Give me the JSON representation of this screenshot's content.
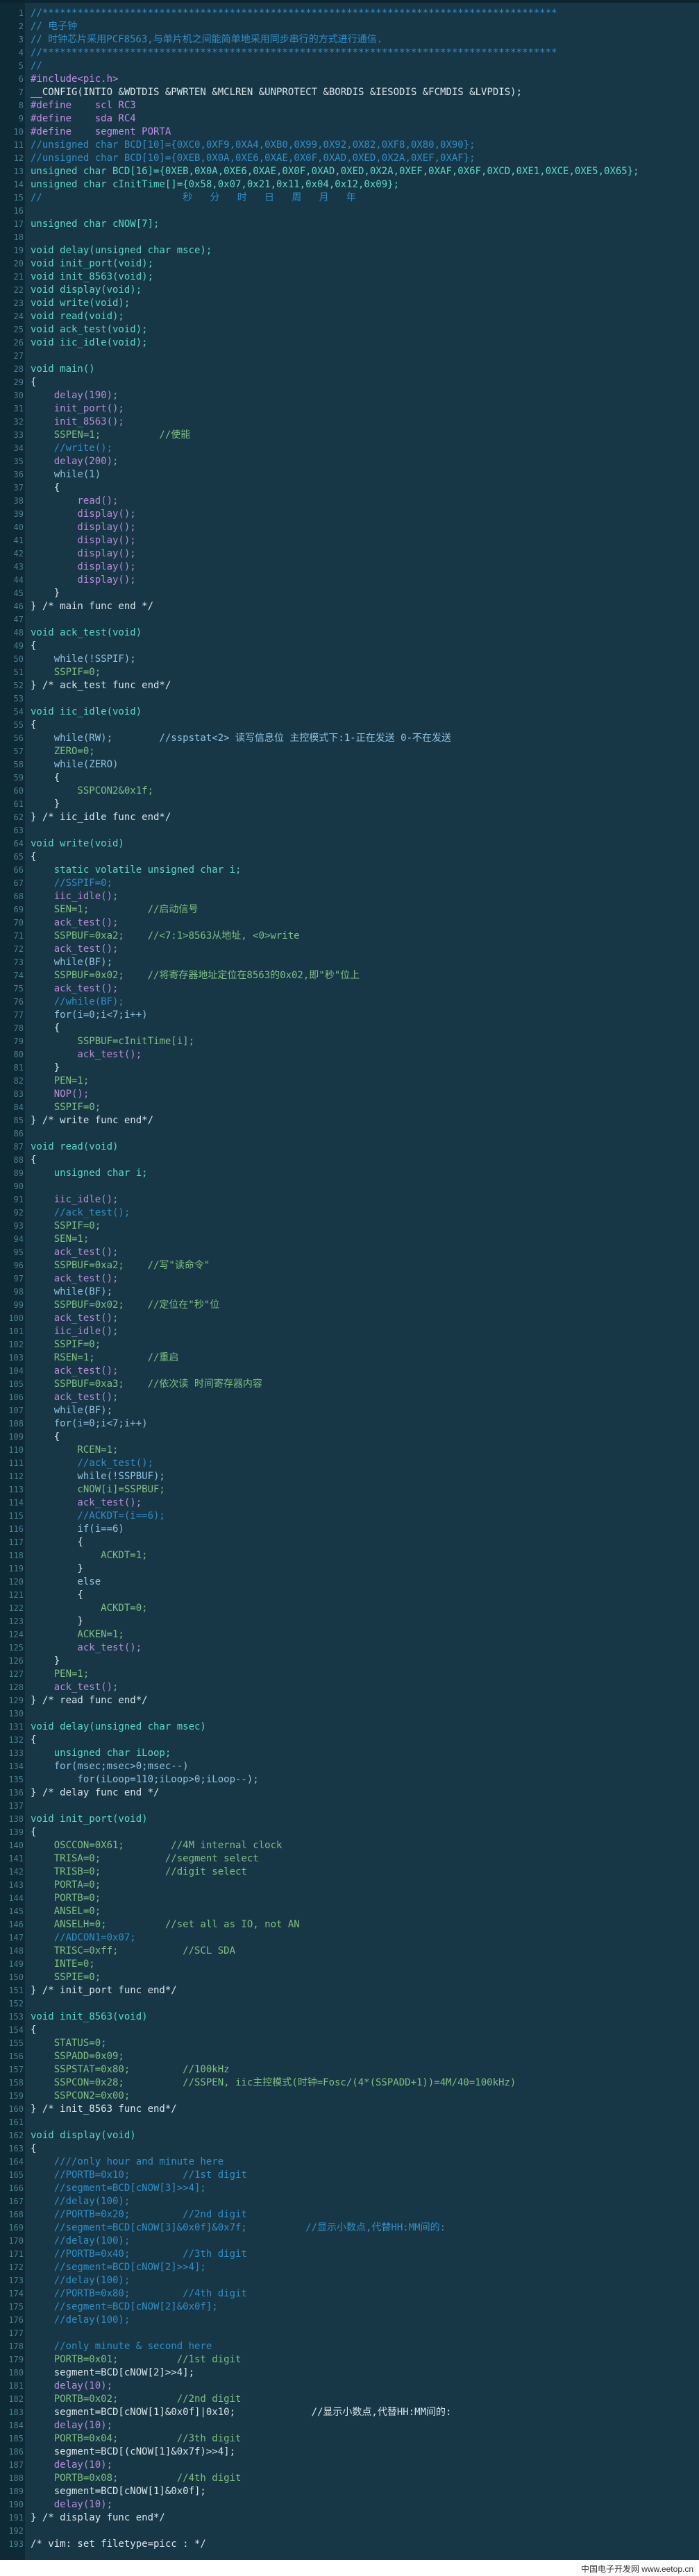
{
  "editor": {
    "lines": [
      {
        "n": "1",
        "t": "//****************************************************************************************",
        "c": "cm"
      },
      {
        "n": "2",
        "t": "// 电子钟",
        "c": "cm"
      },
      {
        "n": "3",
        "t": "// 时钟芯片采用PCF8563,与单片机之间能简单地采用同步串行的方式进行通信.",
        "c": "cm"
      },
      {
        "n": "4",
        "t": "//****************************************************************************************",
        "c": "cm"
      },
      {
        "n": "5",
        "t": "//",
        "c": "cm"
      },
      {
        "n": "6",
        "t": "#include<pic.h>",
        "c": "pp"
      },
      {
        "n": "7",
        "t": "__CONFIG(INTIO &WDTDIS &PWRTEN &MCLREN &UNPROTECT &BORDIS &IESODIS &FCMDIS &LVPDIS);",
        "c": ""
      },
      {
        "n": "8",
        "t": "#define    scl RC3",
        "c": "pp"
      },
      {
        "n": "9",
        "t": "#define    sda RC4",
        "c": "pp"
      },
      {
        "n": "10",
        "t": "#define    segment PORTA",
        "c": "pp"
      },
      {
        "n": "11",
        "t": "//unsigned char BCD[10]={0XC0,0XF9,0XA4,0XB0,0X99,0X92,0X82,0XF8,0X80,0X90};",
        "c": "cm"
      },
      {
        "n": "12",
        "t": "//unsigned char BCD[10]={0XEB,0X0A,0XE6,0XAE,0X0F,0XAD,0XED,0X2A,0XEF,0XAF};",
        "c": "cm"
      },
      {
        "n": "13",
        "t": "unsigned char BCD[16]={0XEB,0X0A,0XE6,0XAE,0X0F,0XAD,0XED,0X2A,0XEF,0XAF,0X6F,0XCD,0XE1,0XCE,0XE5,0X65};",
        "c": "ty"
      },
      {
        "n": "14",
        "t": "unsigned char cInitTime[]={0x58,0x07,0x21,0x11,0x04,0x12,0x09};",
        "c": "ty"
      },
      {
        "n": "15",
        "t": "//                        秒   分   时   日   周   月   年",
        "c": "cm"
      },
      {
        "n": "16",
        "t": "",
        "c": ""
      },
      {
        "n": "17",
        "t": "unsigned char cNOW[7];",
        "c": "ty"
      },
      {
        "n": "18",
        "t": "",
        "c": ""
      },
      {
        "n": "19",
        "t": "void delay(unsigned char msce);",
        "c": "ty"
      },
      {
        "n": "20",
        "t": "void init_port(void);",
        "c": "ty"
      },
      {
        "n": "21",
        "t": "void init_8563(void);",
        "c": "ty"
      },
      {
        "n": "22",
        "t": "void display(void);",
        "c": "ty"
      },
      {
        "n": "23",
        "t": "void write(void);",
        "c": "ty"
      },
      {
        "n": "24",
        "t": "void read(void);",
        "c": "ty"
      },
      {
        "n": "25",
        "t": "void ack_test(void);",
        "c": "ty"
      },
      {
        "n": "26",
        "t": "void iic_idle(void);",
        "c": "ty"
      },
      {
        "n": "27",
        "t": "",
        "c": ""
      },
      {
        "n": "28",
        "t": "void main()",
        "c": "ty"
      },
      {
        "n": "29",
        "t": "{",
        "c": ""
      },
      {
        "n": "30",
        "t": "    delay(190);",
        "c": "fn"
      },
      {
        "n": "31",
        "t": "    init_port();",
        "c": "fn"
      },
      {
        "n": "32",
        "t": "    init_8563();",
        "c": "fn"
      },
      {
        "n": "33",
        "t": "    SSPEN=1;          //使能",
        "c": "gr"
      },
      {
        "n": "34",
        "t": "    //write();",
        "c": "cm"
      },
      {
        "n": "35",
        "t": "    delay(200);",
        "c": "fn"
      },
      {
        "n": "36",
        "t": "    while(1)",
        "c": "kw"
      },
      {
        "n": "37",
        "t": "    {",
        "c": ""
      },
      {
        "n": "38",
        "t": "        read();",
        "c": "fn"
      },
      {
        "n": "39",
        "t": "        display();",
        "c": "fn"
      },
      {
        "n": "40",
        "t": "        display();",
        "c": "fn"
      },
      {
        "n": "41",
        "t": "        display();",
        "c": "fn"
      },
      {
        "n": "42",
        "t": "        display();",
        "c": "fn"
      },
      {
        "n": "43",
        "t": "        display();",
        "c": "fn"
      },
      {
        "n": "44",
        "t": "        display();",
        "c": "fn"
      },
      {
        "n": "45",
        "t": "    }",
        "c": ""
      },
      {
        "n": "46",
        "t": "} /* main func end */",
        "c": ""
      },
      {
        "n": "47",
        "t": "",
        "c": ""
      },
      {
        "n": "48",
        "t": "void ack_test(void)",
        "c": "ty"
      },
      {
        "n": "49",
        "t": "{",
        "c": ""
      },
      {
        "n": "50",
        "t": "    while(!SSPIF);",
        "c": "kw"
      },
      {
        "n": "51",
        "t": "    SSPIF=0;",
        "c": "gr"
      },
      {
        "n": "52",
        "t": "} /* ack_test func end*/",
        "c": ""
      },
      {
        "n": "53",
        "t": "",
        "c": ""
      },
      {
        "n": "54",
        "t": "void iic_idle(void)",
        "c": "ty"
      },
      {
        "n": "55",
        "t": "{",
        "c": ""
      },
      {
        "n": "56",
        "t": "    while(RW);        //sspstat<2> 读写信息位 主控模式下:1-正在发送 0-不在发送",
        "c": "kw"
      },
      {
        "n": "57",
        "t": "    ZERO=0;",
        "c": "gr"
      },
      {
        "n": "58",
        "t": "    while(ZERO)",
        "c": "kw"
      },
      {
        "n": "59",
        "t": "    {",
        "c": ""
      },
      {
        "n": "60",
        "t": "        SSPCON2&0x1f;",
        "c": "gr"
      },
      {
        "n": "61",
        "t": "    }",
        "c": ""
      },
      {
        "n": "62",
        "t": "} /* iic_idle func end*/",
        "c": ""
      },
      {
        "n": "63",
        "t": "",
        "c": ""
      },
      {
        "n": "64",
        "t": "void write(void)",
        "c": "ty"
      },
      {
        "n": "65",
        "t": "{",
        "c": ""
      },
      {
        "n": "66",
        "t": "    static volatile unsigned char i;",
        "c": "ty"
      },
      {
        "n": "67",
        "t": "    //SSPIF=0;",
        "c": "cm"
      },
      {
        "n": "68",
        "t": "    iic_idle();",
        "c": "fn"
      },
      {
        "n": "69",
        "t": "    SEN=1;          //启动信号",
        "c": "gr"
      },
      {
        "n": "70",
        "t": "    ack_test();",
        "c": "fn"
      },
      {
        "n": "71",
        "t": "    SSPBUF=0xa2;    //<7:1>8563从地址, <0>write",
        "c": "gr"
      },
      {
        "n": "72",
        "t": "    ack_test();",
        "c": "fn"
      },
      {
        "n": "73",
        "t": "    while(BF);",
        "c": "kw"
      },
      {
        "n": "74",
        "t": "    SSPBUF=0x02;    //将寄存器地址定位在8563的0x02,即\"秒\"位上",
        "c": "gr"
      },
      {
        "n": "75",
        "t": "    ack_test();",
        "c": "fn"
      },
      {
        "n": "76",
        "t": "    //while(BF);",
        "c": "cm"
      },
      {
        "n": "77",
        "t": "    for(i=0;i<7;i++)",
        "c": "kw"
      },
      {
        "n": "78",
        "t": "    {",
        "c": ""
      },
      {
        "n": "79",
        "t": "        SSPBUF=cInitTime[i];",
        "c": "gr"
      },
      {
        "n": "80",
        "t": "        ack_test();",
        "c": "fn"
      },
      {
        "n": "81",
        "t": "    }",
        "c": ""
      },
      {
        "n": "82",
        "t": "    PEN=1;",
        "c": "gr"
      },
      {
        "n": "83",
        "t": "    NOP();",
        "c": "fn"
      },
      {
        "n": "84",
        "t": "    SSPIF=0;",
        "c": "gr"
      },
      {
        "n": "85",
        "t": "} /* write func end*/",
        "c": ""
      },
      {
        "n": "86",
        "t": "",
        "c": ""
      },
      {
        "n": "87",
        "t": "void read(void)",
        "c": "ty"
      },
      {
        "n": "88",
        "t": "{",
        "c": ""
      },
      {
        "n": "89",
        "t": "    unsigned char i;",
        "c": "ty"
      },
      {
        "n": "90",
        "t": "",
        "c": ""
      },
      {
        "n": "91",
        "t": "    iic_idle();",
        "c": "fn"
      },
      {
        "n": "92",
        "t": "    //ack_test();",
        "c": "cm"
      },
      {
        "n": "93",
        "t": "    SSPIF=0;",
        "c": "gr"
      },
      {
        "n": "94",
        "t": "    SEN=1;",
        "c": "gr"
      },
      {
        "n": "95",
        "t": "    ack_test();",
        "c": "fn"
      },
      {
        "n": "96",
        "t": "    SSPBUF=0xa2;    //写\"读命令\"",
        "c": "gr"
      },
      {
        "n": "97",
        "t": "    ack_test();",
        "c": "fn"
      },
      {
        "n": "98",
        "t": "    while(BF);",
        "c": "kw"
      },
      {
        "n": "99",
        "t": "    SSPBUF=0x02;    //定位在\"秒\"位",
        "c": "gr"
      },
      {
        "n": "100",
        "t": "    ack_test();",
        "c": "fn"
      },
      {
        "n": "101",
        "t": "    iic_idle();",
        "c": "fn"
      },
      {
        "n": "102",
        "t": "    SSPIF=0;",
        "c": "gr"
      },
      {
        "n": "103",
        "t": "    RSEN=1;         //重启",
        "c": "gr"
      },
      {
        "n": "104",
        "t": "    ack_test();",
        "c": "fn"
      },
      {
        "n": "105",
        "t": "    SSPBUF=0xa3;    //依次读 时间寄存器内容",
        "c": "gr"
      },
      {
        "n": "106",
        "t": "    ack_test();",
        "c": "fn"
      },
      {
        "n": "107",
        "t": "    while(BF);",
        "c": "kw"
      },
      {
        "n": "108",
        "t": "    for(i=0;i<7;i++)",
        "c": "kw"
      },
      {
        "n": "109",
        "t": "    {",
        "c": ""
      },
      {
        "n": "110",
        "t": "        RCEN=1;",
        "c": "gr"
      },
      {
        "n": "111",
        "t": "        //ack_test();",
        "c": "cm"
      },
      {
        "n": "112",
        "t": "        while(!SSPBUF);",
        "c": "kw"
      },
      {
        "n": "113",
        "t": "        cNOW[i]=SSPBUF;",
        "c": "gr"
      },
      {
        "n": "114",
        "t": "        ack_test();",
        "c": "fn"
      },
      {
        "n": "115",
        "t": "        //ACKDT=(i==6);",
        "c": "cm"
      },
      {
        "n": "116",
        "t": "        if(i==6)",
        "c": "kw"
      },
      {
        "n": "117",
        "t": "        {",
        "c": ""
      },
      {
        "n": "118",
        "t": "            ACKDT=1;",
        "c": "gr"
      },
      {
        "n": "119",
        "t": "        }",
        "c": ""
      },
      {
        "n": "120",
        "t": "        else",
        "c": "kw"
      },
      {
        "n": "121",
        "t": "        {",
        "c": ""
      },
      {
        "n": "122",
        "t": "            ACKDT=0;",
        "c": "gr"
      },
      {
        "n": "123",
        "t": "        }",
        "c": ""
      },
      {
        "n": "124",
        "t": "        ACKEN=1;",
        "c": "gr"
      },
      {
        "n": "125",
        "t": "        ack_test();",
        "c": "fn"
      },
      {
        "n": "126",
        "t": "    }",
        "c": ""
      },
      {
        "n": "127",
        "t": "    PEN=1;",
        "c": "gr"
      },
      {
        "n": "128",
        "t": "    ack_test();",
        "c": "fn"
      },
      {
        "n": "129",
        "t": "} /* read func end*/",
        "c": ""
      },
      {
        "n": "130",
        "t": "",
        "c": ""
      },
      {
        "n": "131",
        "t": "void delay(unsigned char msec)",
        "c": "ty"
      },
      {
        "n": "132",
        "t": "{",
        "c": ""
      },
      {
        "n": "133",
        "t": "    unsigned char iLoop;",
        "c": "ty"
      },
      {
        "n": "134",
        "t": "    for(msec;msec>0;msec--)",
        "c": "kw"
      },
      {
        "n": "135",
        "t": "        for(iLoop=110;iLoop>0;iLoop--);",
        "c": "kw"
      },
      {
        "n": "136",
        "t": "} /* delay func end */",
        "c": ""
      },
      {
        "n": "137",
        "t": "",
        "c": ""
      },
      {
        "n": "138",
        "t": "void init_port(void)",
        "c": "ty"
      },
      {
        "n": "139",
        "t": "{",
        "c": ""
      },
      {
        "n": "140",
        "t": "    OSCCON=0X61;        //4M internal clock",
        "c": "gr"
      },
      {
        "n": "141",
        "t": "    TRISA=0;           //segment select",
        "c": "gr"
      },
      {
        "n": "142",
        "t": "    TRISB=0;           //digit select",
        "c": "gr"
      },
      {
        "n": "143",
        "t": "    PORTA=0;",
        "c": "gr"
      },
      {
        "n": "144",
        "t": "    PORTB=0;",
        "c": "gr"
      },
      {
        "n": "145",
        "t": "    ANSEL=0;",
        "c": "gr"
      },
      {
        "n": "146",
        "t": "    ANSELH=0;          //set all as IO, not AN",
        "c": "gr"
      },
      {
        "n": "147",
        "t": "    //ADCON1=0x07;",
        "c": "cm"
      },
      {
        "n": "148",
        "t": "    TRISC=0xff;           //SCL SDA",
        "c": "gr"
      },
      {
        "n": "149",
        "t": "    INTE=0;",
        "c": "gr"
      },
      {
        "n": "150",
        "t": "    SSPIE=0;",
        "c": "gr"
      },
      {
        "n": "151",
        "t": "} /* init_port func end*/",
        "c": ""
      },
      {
        "n": "152",
        "t": "",
        "c": ""
      },
      {
        "n": "153",
        "t": "void init_8563(void)",
        "c": "ty"
      },
      {
        "n": "154",
        "t": "{",
        "c": ""
      },
      {
        "n": "155",
        "t": "    STATUS=0;",
        "c": "gr"
      },
      {
        "n": "156",
        "t": "    SSPADD=0x09;",
        "c": "gr"
      },
      {
        "n": "157",
        "t": "    SSPSTAT=0x80;         //100kHz",
        "c": "gr"
      },
      {
        "n": "158",
        "t": "    SSPCON=0x28;          //SSPEN, iic主控模式(时钟=Fosc/(4*(SSPADD+1))=4M/40=100kHz)",
        "c": "gr"
      },
      {
        "n": "159",
        "t": "    SSPCON2=0x00;",
        "c": "gr"
      },
      {
        "n": "160",
        "t": "} /* init_8563 func end*/",
        "c": ""
      },
      {
        "n": "161",
        "t": "",
        "c": ""
      },
      {
        "n": "162",
        "t": "void display(void)",
        "c": "ty"
      },
      {
        "n": "163",
        "t": "{",
        "c": ""
      },
      {
        "n": "164",
        "t": "    ////only hour and minute here",
        "c": "cm"
      },
      {
        "n": "165",
        "t": "    //PORTB=0x10;         //1st digit",
        "c": "cm"
      },
      {
        "n": "166",
        "t": "    //segment=BCD[cNOW[3]>>4];",
        "c": "cm"
      },
      {
        "n": "167",
        "t": "    //delay(100);",
        "c": "cm"
      },
      {
        "n": "168",
        "t": "    //PORTB=0x20;         //2nd digit",
        "c": "cm"
      },
      {
        "n": "169",
        "t": "    //segment=BCD[cNOW[3]&0x0f]&0x7f;          //显示小数点,代替HH:MM间的:",
        "c": "cm"
      },
      {
        "n": "170",
        "t": "    //delay(100);",
        "c": "cm"
      },
      {
        "n": "171",
        "t": "    //PORTB=0x40;         //3th digit",
        "c": "cm"
      },
      {
        "n": "172",
        "t": "    //segment=BCD[cNOW[2]>>4];",
        "c": "cm"
      },
      {
        "n": "173",
        "t": "    //delay(100);",
        "c": "cm"
      },
      {
        "n": "174",
        "t": "    //PORTB=0x80;         //4th digit",
        "c": "cm"
      },
      {
        "n": "175",
        "t": "    //segment=BCD[cNOW[2]&0x0f];",
        "c": "cm"
      },
      {
        "n": "176",
        "t": "    //delay(100);",
        "c": "cm"
      },
      {
        "n": "177",
        "t": "",
        "c": ""
      },
      {
        "n": "178",
        "t": "    //only minute & second here",
        "c": "cm"
      },
      {
        "n": "179",
        "t": "    PORTB=0x01;          //1st digit",
        "c": "gr"
      },
      {
        "n": "180",
        "t": "    segment=BCD[cNOW[2]>>4];",
        "c": ""
      },
      {
        "n": "181",
        "t": "    delay(10);",
        "c": "fn"
      },
      {
        "n": "182",
        "t": "    PORTB=0x02;          //2nd digit",
        "c": "gr"
      },
      {
        "n": "183",
        "t": "    segment=BCD[cNOW[1]&0x0f]|0x10;             //显示小数点,代替HH:MM间的:",
        "c": ""
      },
      {
        "n": "184",
        "t": "    delay(10);",
        "c": "fn"
      },
      {
        "n": "185",
        "t": "    PORTB=0x04;          //3th digit",
        "c": "gr"
      },
      {
        "n": "186",
        "t": "    segment=BCD[(cNOW[1]&0x7f)>>4];",
        "c": ""
      },
      {
        "n": "187",
        "t": "    delay(10);",
        "c": "fn"
      },
      {
        "n": "188",
        "t": "    PORTB=0x08;          //4th digit",
        "c": "gr"
      },
      {
        "n": "189",
        "t": "    segment=BCD[cNOW[1]&0x0f];",
        "c": ""
      },
      {
        "n": "190",
        "t": "    delay(10);",
        "c": "fn"
      },
      {
        "n": "191",
        "t": "} /* display func end*/",
        "c": ""
      },
      {
        "n": "192",
        "t": "",
        "c": ""
      },
      {
        "n": "193",
        "t": "/* vim: set filetype=picc : */",
        "c": ""
      }
    ]
  },
  "footer": {
    "watermark": "中国电子开发网 www.eetop.cn"
  }
}
